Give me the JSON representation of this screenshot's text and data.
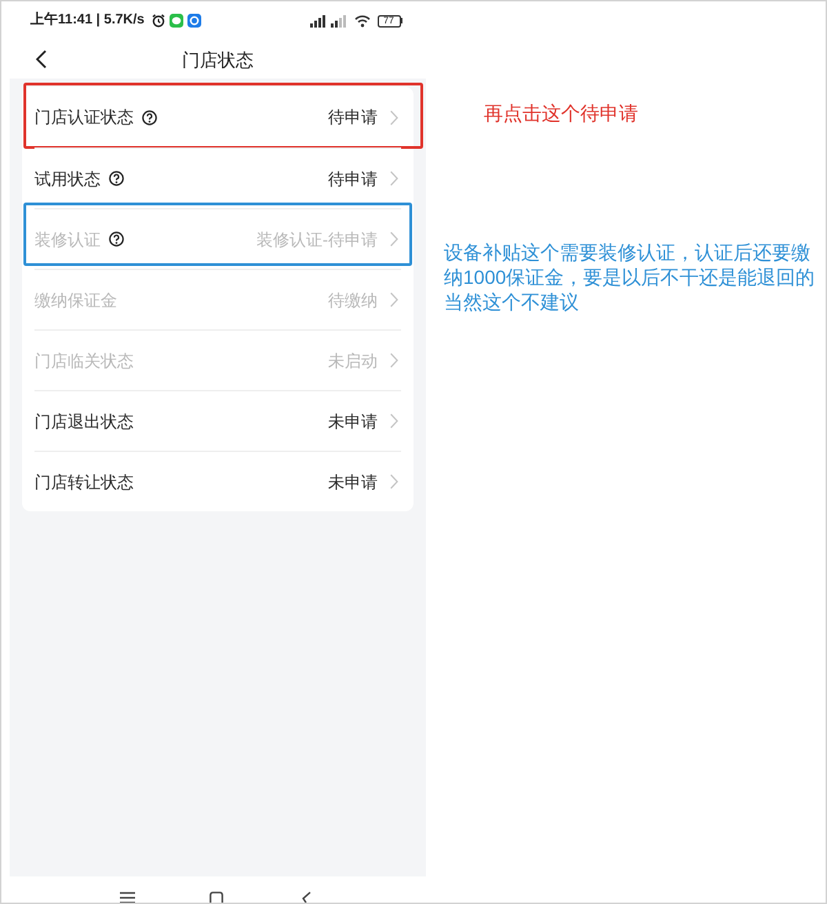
{
  "status_bar": {
    "time_speed": "上午11:41 | 5.7K/s",
    "battery": "77"
  },
  "header": {
    "title": "门店状态"
  },
  "rows": [
    {
      "label": "门店认证状态",
      "help": true,
      "status": "待申请",
      "disabled": false,
      "note": {
        "text": "再点击这个待申请",
        "color": "#e0332b"
      }
    },
    {
      "label": "试用状态",
      "help": true,
      "status": "待申请",
      "disabled": false
    },
    {
      "label": "装修认证",
      "help": true,
      "status": "装修认证-待申请",
      "disabled": true,
      "note": {
        "text": "设备补贴这个需要装修认证，认证后还要缴纳1000保证金，要是以后不干还是能退回的当然这个不建议",
        "color": "#2e90d6"
      }
    },
    {
      "label": "缴纳保证金",
      "help": false,
      "status": "待缴纳",
      "disabled": true
    },
    {
      "label": "门店临关状态",
      "help": false,
      "status": "未启动",
      "disabled": true
    },
    {
      "label": "门店退出状态",
      "help": false,
      "status": "未申请",
      "disabled": false
    },
    {
      "label": "门店转让状态",
      "help": false,
      "status": "未申请",
      "disabled": false
    }
  ]
}
